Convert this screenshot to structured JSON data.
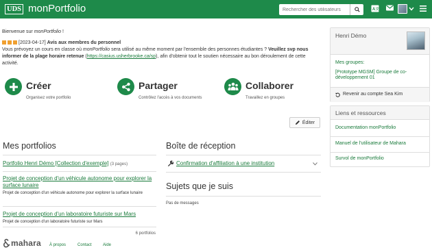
{
  "header": {
    "logo_box": "UDS",
    "logo_text": "monPortfolio",
    "search_placeholder": "Rechercher des utilisateurs"
  },
  "welcome": {
    "prefix": "Bienvenue sur ",
    "app": "monPortfolio",
    "suffix": " !"
  },
  "notice": {
    "date": "[2023-04-17]",
    "title": "Avis aux membres du personnel",
    "p1": "Vous prévoyez un cours en classe où ",
    "app": "monPortfolio",
    "p2": " sera utilisé au même moment par l'ensemble des personnes étudiantes ? ",
    "bold": "Veuillez svp nous informer de la plage horaire retenue",
    "link_open": " (",
    "link": "https://casius.usherbrooke.ca/sp",
    "link_close": ")",
    "p3": ", afin d'obtenir tout le soutien nécessaire au bon déroulement de cette activité."
  },
  "features": [
    {
      "title": "Créer",
      "subtitle": "Organisez votre portfolio"
    },
    {
      "title": "Partager",
      "subtitle": "Contrôlez l'accès à vos documents"
    },
    {
      "title": "Collaborer",
      "subtitle": "Travaillez en groupes"
    }
  ],
  "edit_label": "Éditer",
  "portfolios": {
    "title": "Mes portfolios",
    "items": [
      {
        "title": "Portfolio Henri Démo [Collection d'exemple]",
        "meta": "(3 pages)",
        "desc": ""
      },
      {
        "title": "Projet de conception d'un véhicule autonome pour explorer la surface lunaire",
        "meta": "",
        "desc": "Projet de conception d'un véhicule autonome pour explorer la surface lunaire"
      },
      {
        "title": "Projet de conception d'un laboratoire futuriste sur Mars",
        "meta": "",
        "desc": "Projet de conception d'un laboratoire futuriste sur Mars"
      }
    ],
    "count": "6 portfolios"
  },
  "inbox": {
    "title": "Boîte de réception",
    "item": "Confirmation d'affiliation à une institution"
  },
  "watched": {
    "title": "Sujets que je suis",
    "empty": "Pas de messages"
  },
  "footer": {
    "brand": "mahara",
    "links": [
      "À propos",
      "Contact",
      "Aide"
    ]
  },
  "sidebar": {
    "user_name": "Henri Démo",
    "groups_label": "Mes groupes:",
    "group": "[Prototype MGSM] Groupe de co-développement 01",
    "return_label": "Revenir au compte Sea Kim",
    "links_title": "Liens et ressources",
    "links": [
      "Documentation monPortfolio",
      "Manuel de l'utilisateur de Mahara",
      "Survol de monPortfolio"
    ]
  },
  "colors": {
    "brand": "#1e8a4a",
    "link": "#187a3a",
    "notice_square": "#f0a030"
  }
}
